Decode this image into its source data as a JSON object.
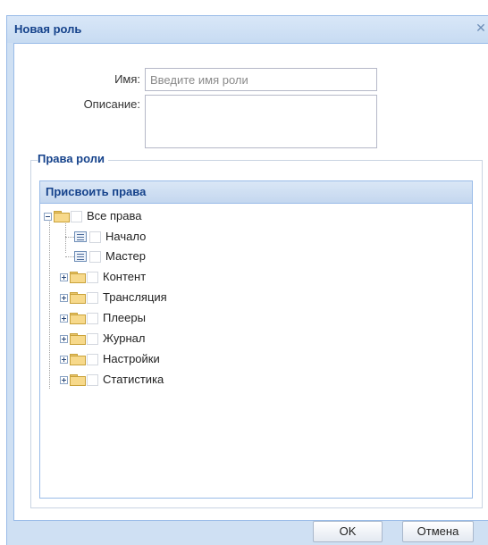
{
  "dialog": {
    "title": "Новая роль",
    "close_symbol": "✕"
  },
  "form": {
    "name_label": "Имя:",
    "name_placeholder": "Введите имя роли",
    "name_value": "",
    "description_label": "Описание:",
    "description_value": ""
  },
  "rights": {
    "section_title": "Права роли",
    "panel_title": "Присвоить права",
    "tree": {
      "root": {
        "label": "Все права",
        "expanded": true,
        "checked": false,
        "icon": "folder-open-icon"
      },
      "leaves": [
        {
          "label": "Начало",
          "checked": false,
          "icon": "page-icon"
        },
        {
          "label": "Мастер",
          "checked": false,
          "icon": "page-icon"
        }
      ],
      "folders": [
        {
          "label": "Контент",
          "expanded": false,
          "checked": false,
          "icon": "folder-icon"
        },
        {
          "label": "Трансляция",
          "expanded": false,
          "checked": false,
          "icon": "folder-icon"
        },
        {
          "label": "Плееры",
          "expanded": false,
          "checked": false,
          "icon": "folder-icon"
        },
        {
          "label": "Журнал",
          "expanded": false,
          "checked": false,
          "icon": "folder-icon"
        },
        {
          "label": "Настройки",
          "expanded": false,
          "checked": false,
          "icon": "folder-icon"
        },
        {
          "label": "Статистика",
          "expanded": false,
          "checked": false,
          "icon": "folder-icon"
        }
      ]
    }
  },
  "buttons": {
    "ok_label": "OK",
    "cancel_label": "Отмена"
  },
  "colors": {
    "title_text": "#15428b",
    "window_frame": "#cfe0f3",
    "border": "#99bbe8"
  }
}
